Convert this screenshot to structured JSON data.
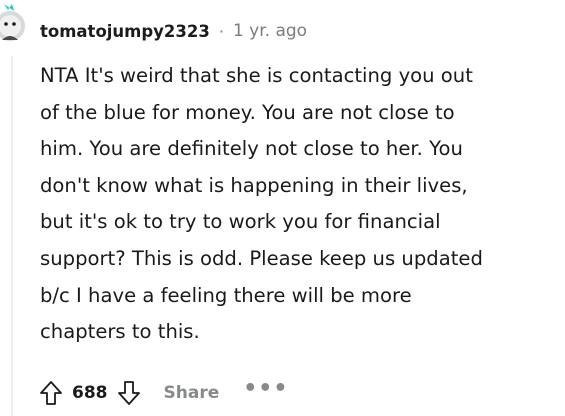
{
  "comment": {
    "username": "tomatojumpy2323",
    "separator": "·",
    "timestamp": "1 yr. ago",
    "body": "NTA It's weird that she is contacting you out\nof the blue for money. You are not close to\nhim. You are definitely not close to her. You\ndon't know what is happening in their lives,\nbut it's ok to try to work you for financial\nsupport? This is odd. Please keep us updated\nb/c I have a feeling there will be more\nchapters to this."
  },
  "actions": {
    "upvote_icon": "arrow-up-outline-icon",
    "score": "688",
    "downvote_icon": "arrow-down-outline-icon",
    "share_label": "Share",
    "more_label": "•••"
  },
  "colors": {
    "text": "#1a1a1b",
    "meta": "#7c7c7c",
    "action_muted": "#878a8c",
    "avatar_accent": "#0dd3bb"
  }
}
